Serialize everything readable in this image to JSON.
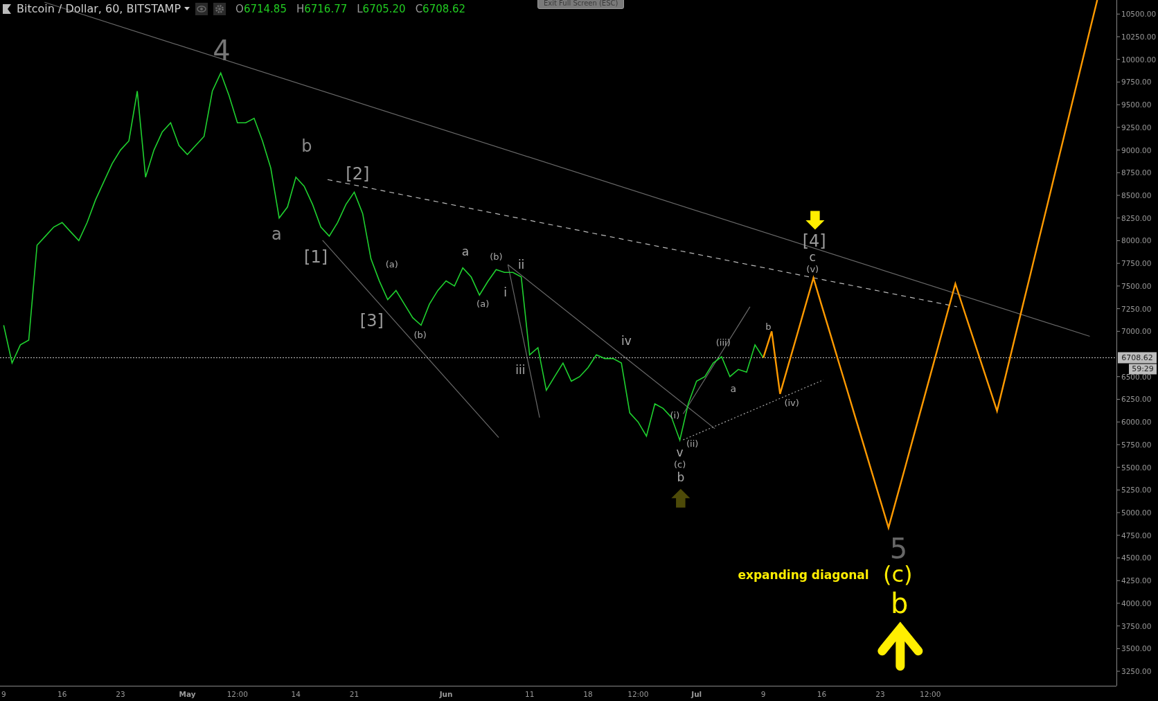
{
  "header": {
    "symbol": "Bitcoin / Dollar, 60, BITSTAMP",
    "ohlc": [
      {
        "key": "O",
        "value": "6714.85"
      },
      {
        "key": "H",
        "value": "6716.77"
      },
      {
        "key": "L",
        "value": "6705.20"
      },
      {
        "key": "C",
        "value": "6708.62"
      }
    ]
  },
  "exit_button": "Exit Full Screen (ESC)",
  "chart": {
    "chart_data": {
      "type": "line",
      "categories": [
        "9",
        null,
        null,
        null,
        null,
        null,
        null,
        "16",
        null,
        null,
        null,
        null,
        null,
        null,
        "23",
        null,
        null,
        null,
        null,
        null,
        null,
        null,
        "May",
        null,
        null,
        null,
        null,
        null,
        "12:00",
        null,
        null,
        null,
        null,
        null,
        null,
        "14",
        null,
        null,
        null,
        null,
        null,
        null,
        "21",
        null,
        null,
        null,
        null,
        null,
        null,
        null,
        null,
        null,
        null,
        "Jun",
        null,
        null,
        null,
        null,
        null,
        null,
        null,
        null,
        null,
        "11",
        null,
        null,
        null,
        null,
        null,
        null,
        "18",
        null,
        null,
        null,
        null,
        null,
        "12:00",
        null,
        null,
        null,
        null,
        null,
        null,
        "Jul",
        null,
        null,
        null,
        null,
        null,
        null,
        null,
        "9",
        null,
        null,
        null,
        null,
        null,
        null,
        "16",
        null,
        null,
        null,
        null,
        null,
        null,
        "23",
        null,
        null,
        null,
        null,
        null,
        "12:00",
        null,
        null,
        null,
        null,
        null,
        null,
        null,
        null,
        null,
        null,
        null,
        null,
        null,
        null,
        null,
        null,
        null,
        null,
        null,
        null,
        null,
        null
      ],
      "series": [
        {
          "color": "#1fd12f",
          "values": [
            7067,
            6650,
            6850,
            6904,
            7950,
            8050,
            8150,
            8200,
            8100,
            8000,
            8200,
            8450,
            8650,
            8850,
            9000,
            9100,
            9650,
            8700,
            9000,
            9200,
            9300,
            9050,
            8950,
            9050,
            9150,
            9650,
            9850,
            9600,
            9300,
            9300,
            9350,
            9100,
            8800,
            8250,
            8372,
            8700,
            8600,
            8400,
            8150,
            8050,
            8200,
            8400,
            8535,
            8300,
            7800,
            7556,
            7350,
            7450,
            7300,
            7150,
            7067,
            7300,
            7450,
            7556,
            7500,
            7700,
            7600,
            7400,
            7550,
            7680,
            7650,
            7650,
            7600,
            6740,
            6820,
            6350,
            6500,
            6650,
            6450,
            6500,
            6600,
            6740,
            6700,
            6700,
            6650,
            6100,
            6000,
            5844,
            6200,
            6150,
            6050,
            5800,
            6200,
            6450,
            6500,
            6650,
            6720,
            6500,
            6580,
            6550,
            6850,
            6708,
            null,
            null,
            null,
            null,
            null,
            null,
            null,
            null,
            null,
            null,
            null,
            null,
            null,
            null,
            null,
            null,
            null,
            null,
            null,
            null,
            null,
            null,
            null,
            null,
            null,
            null,
            null,
            null,
            null,
            null,
            null,
            null,
            null,
            null,
            null,
            null,
            null,
            null,
            null,
            null,
            null,
            null
          ]
        },
        {
          "color": "#ff9a00",
          "values": [
            null,
            null,
            null,
            null,
            null,
            null,
            null,
            null,
            null,
            null,
            null,
            null,
            null,
            null,
            null,
            null,
            null,
            null,
            null,
            null,
            null,
            null,
            null,
            null,
            null,
            null,
            null,
            null,
            null,
            null,
            null,
            null,
            null,
            null,
            null,
            null,
            null,
            null,
            null,
            null,
            null,
            null,
            null,
            null,
            null,
            null,
            null,
            null,
            null,
            null,
            null,
            null,
            null,
            null,
            null,
            null,
            null,
            null,
            null,
            null,
            null,
            null,
            null,
            null,
            null,
            null,
            null,
            null,
            null,
            null,
            null,
            null,
            null,
            null,
            null,
            null,
            null,
            null,
            null,
            null,
            null,
            null,
            null,
            null,
            null,
            null,
            null,
            null,
            null,
            null,
            null,
            6708,
            7000,
            6309,
            6629,
            6949,
            7269,
            7589,
            7283,
            6977,
            6670,
            6364,
            6058,
            5752,
            5446,
            5139,
            4833,
            5169,
            5505,
            5842,
            6178,
            6514,
            6851,
            7187,
            7524,
            7243,
            6962,
            6682,
            6401,
            6121,
            6499,
            6877,
            7255,
            7633,
            8011,
            8388,
            8766,
            9144,
            9522,
            9900,
            10278,
            10655,
            null,
            null
          ]
        }
      ],
      "ylim": [
        3090,
        10655
      ],
      "ref_lines": [
        {
          "axis": "y",
          "value": 6708.62,
          "label": "6708.62"
        }
      ],
      "yticks": [
        {
          "value": 3250,
          "label": "3250.00"
        },
        {
          "value": 3500,
          "label": "3500.00"
        },
        {
          "value": 3750,
          "label": "3750.00"
        },
        {
          "value": 4000,
          "label": "4000.00"
        },
        {
          "value": 4250,
          "label": "4250.00"
        },
        {
          "value": 4500,
          "label": "4500.00"
        },
        {
          "value": 4750,
          "label": "4750.00"
        },
        {
          "value": 5000,
          "label": "5000.00"
        },
        {
          "value": 5250,
          "label": "5250.00"
        },
        {
          "value": 5500,
          "label": "5500.00"
        },
        {
          "value": 5750,
          "label": "5750.00"
        },
        {
          "value": 6000,
          "label": "6000.00"
        },
        {
          "value": 6250,
          "label": "6250.00"
        },
        {
          "value": 6500,
          "label": "6500.00"
        },
        {
          "value": 7000,
          "label": "7000.00"
        },
        {
          "value": 7250,
          "label": "7250.00"
        },
        {
          "value": 7500,
          "label": "7500.00"
        },
        {
          "value": 7750,
          "label": "7750.00"
        },
        {
          "value": 8000,
          "label": "8000.00"
        },
        {
          "value": 8250,
          "label": "8250.00"
        },
        {
          "value": 8500,
          "label": "8500.00"
        },
        {
          "value": 8750,
          "label": "8750.00"
        },
        {
          "value": 9000,
          "label": "9000.00"
        },
        {
          "value": 9250,
          "label": "9250.00"
        },
        {
          "value": 9500,
          "label": "9500.00"
        },
        {
          "value": 9750,
          "label": "9750.00"
        },
        {
          "value": 10000,
          "label": "10000.00"
        },
        {
          "value": 10250,
          "label": "10250.00"
        },
        {
          "value": 10500,
          "label": "10500.00"
        }
      ]
    },
    "countdown": "59:29",
    "wave_labels": [
      {
        "text": "4",
        "color": "#777777"
      },
      {
        "text": "b",
        "color": "#8a8a8a"
      },
      {
        "text": "a",
        "color": "#8a8a8a"
      },
      {
        "text": "[2]",
        "color": "#9a9a9a"
      },
      {
        "text": "[1]",
        "color": "#9a9a9a"
      },
      {
        "text": "[3]",
        "color": "#9a9a9a"
      },
      {
        "text": "(a)",
        "color": "#aaaaaa"
      },
      {
        "text": "(b)",
        "color": "#aaaaaa"
      },
      {
        "text": "a",
        "color": "#aaaaaa"
      },
      {
        "text": "(a)",
        "color": "#aaaaaa"
      },
      {
        "text": "(b)",
        "color": "#aaaaaa"
      },
      {
        "text": "ii",
        "color": "#aaaaaa"
      },
      {
        "text": "i",
        "color": "#aaaaaa"
      },
      {
        "text": "iii",
        "color": "#aaaaaa"
      },
      {
        "text": "iv",
        "color": "#aaaaaa"
      },
      {
        "text": "(iii)",
        "color": "#aaaaaa"
      },
      {
        "text": "b",
        "color": "#aaaaaa"
      },
      {
        "text": "a",
        "color": "#aaaaaa"
      },
      {
        "text": "(i)",
        "color": "#aaaaaa"
      },
      {
        "text": "(ii)",
        "color": "#aaaaaa"
      },
      {
        "text": "v",
        "color": "#aaaaaa"
      },
      {
        "text": "(c)",
        "color": "#aaaaaa"
      },
      {
        "text": "b",
        "color": "#aaaaaa"
      },
      {
        "text": "[4]",
        "color": "#9a9a9a"
      },
      {
        "text": "c",
        "color": "#aaaaaa"
      },
      {
        "text": "(v)",
        "color": "#aaaaaa"
      },
      {
        "text": "(iv)",
        "color": "#aaaaaa"
      },
      {
        "text": "5",
        "color": "#666666"
      },
      {
        "text": "expanding diagonal",
        "color": "#ffee00"
      },
      {
        "text": "(c)",
        "color": "#ffee00"
      },
      {
        "text": "b",
        "color": "#ffee00"
      }
    ]
  }
}
